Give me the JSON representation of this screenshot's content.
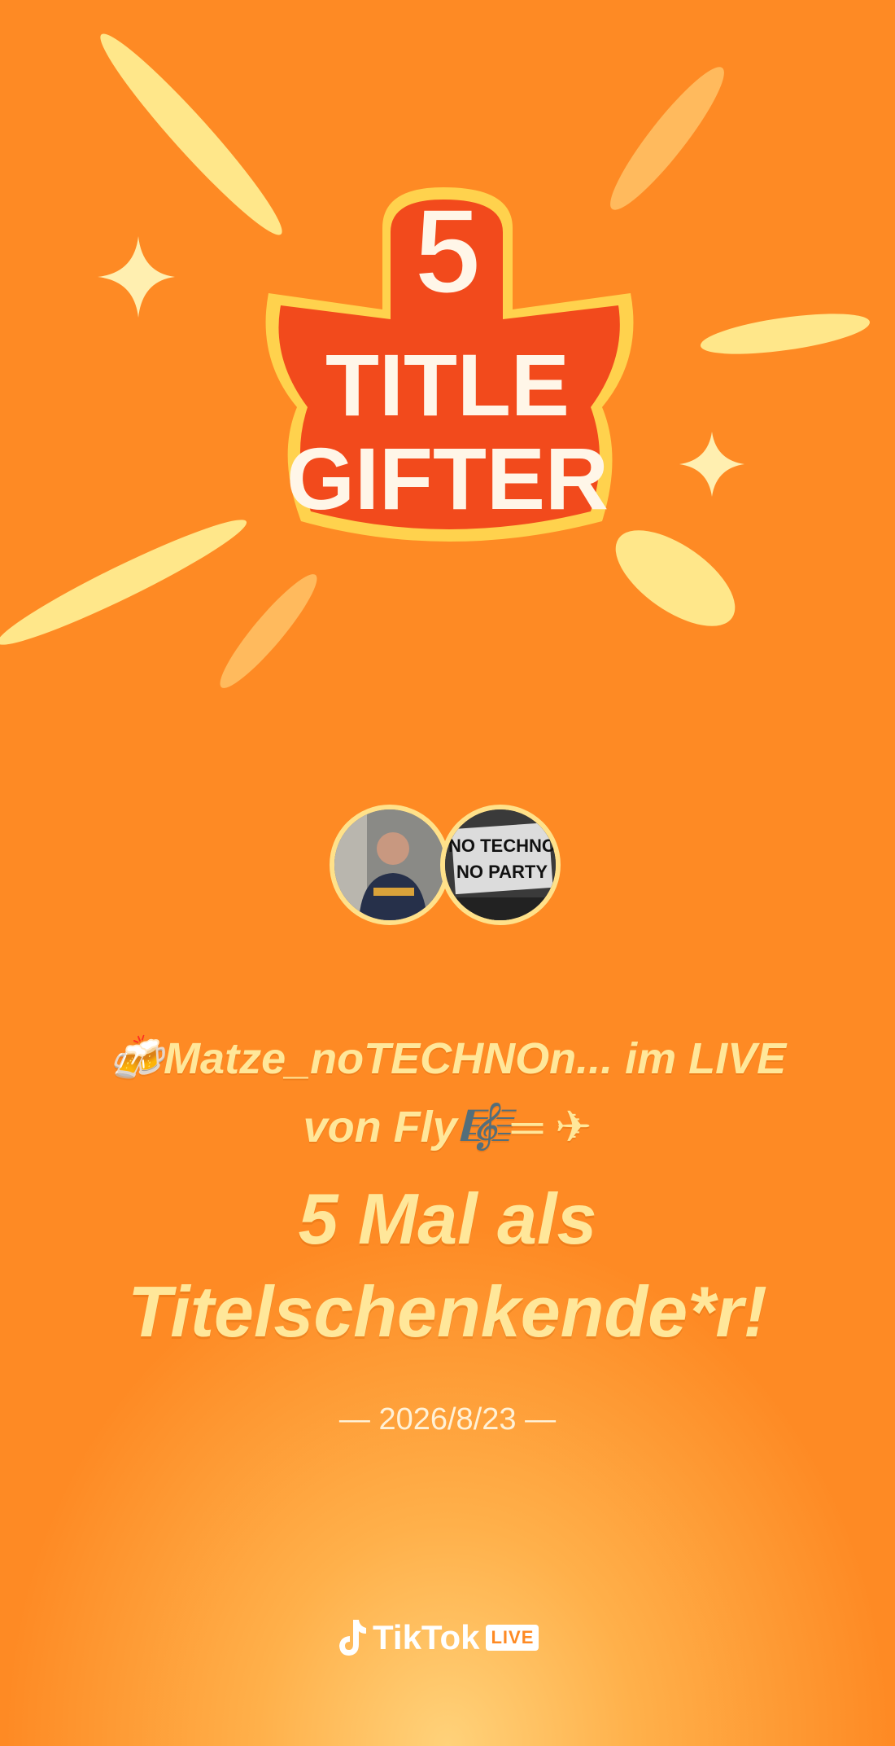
{
  "badge": {
    "number": "5",
    "line1": "TITLE",
    "line2": "GIFTER"
  },
  "avatars": [
    {
      "name": "host-avatar"
    },
    {
      "name": "gifter-avatar",
      "sign_line1": "NO TECHNO",
      "sign_line2": "NO PARTY"
    }
  ],
  "message": {
    "emoji_prefix": "🍻",
    "line1": "Matze_noTECHNOn... im LIVE",
    "line1b": "von Fly🎼═ ✈",
    "headline_l1": "5 Mal als",
    "headline_l2": "Titelschenkende*r!"
  },
  "date": "— 2026/8/23 —",
  "brand": {
    "name": "TikTok",
    "tag": "LIVE"
  }
}
